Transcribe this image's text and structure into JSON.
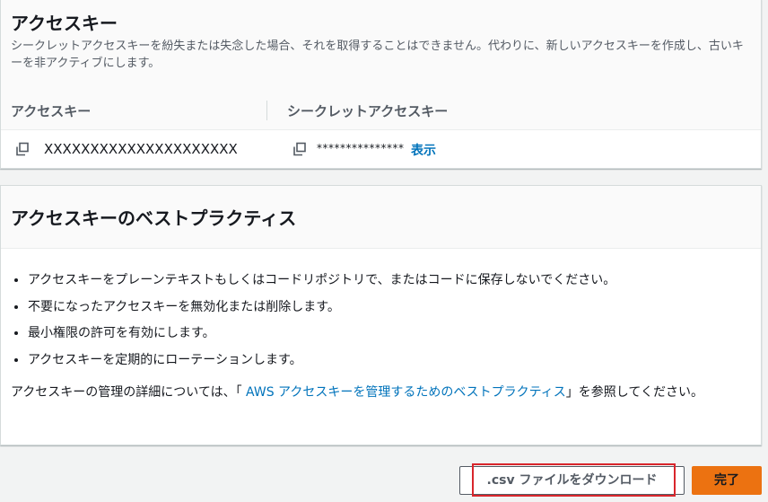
{
  "keys_panel": {
    "title": "アクセスキー",
    "description": "シークレットアクセスキーを紛失または失念した場合、それを取得することはできません。代わりに、新しいアクセスキーを作成し、古いキーを非アクティブにします。",
    "columns": {
      "access_key": "アクセスキー",
      "secret_key": "シークレットアクセスキー"
    },
    "row": {
      "access_key_value": "XXXXXXXXXXXXXXXXXXXXX",
      "secret_masked": "***************",
      "show_link": "表示"
    }
  },
  "best_practices": {
    "title": "アクセスキーのベストプラクティス",
    "items": [
      "アクセスキーをプレーンテキストもしくはコードリポジトリで、またはコードに保存しないでください。",
      "不要になったアクセスキーを無効化または削除します。",
      "最小権限の許可を有効にします。",
      "アクセスキーを定期的にローテーションします。"
    ],
    "more_prefix": "アクセスキーの管理の詳細については、「",
    "more_link": " AWS アクセスキーを管理するためのベストプラクティス",
    "more_suffix": "」を参照してください。"
  },
  "footer": {
    "csv_button": ".csv ファイルをダウンロード",
    "done_button": "完了"
  },
  "colors": {
    "link": "#0073bb",
    "primary": "#ec7211",
    "highlight": "#d9262c"
  },
  "icons": [
    "copy-icon"
  ]
}
